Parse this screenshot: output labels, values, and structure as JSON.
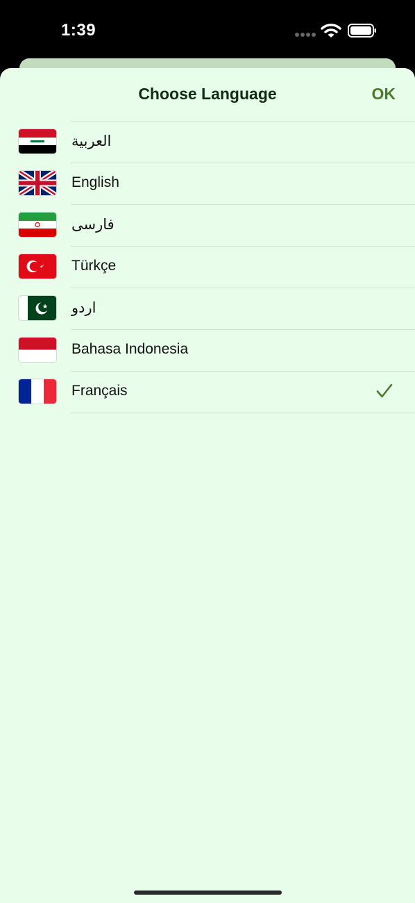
{
  "status_bar": {
    "time": "1:39",
    "icons": [
      "cellular-signal-icon",
      "wifi-icon",
      "battery-icon"
    ]
  },
  "sheet": {
    "title": "Choose Language",
    "ok_label": "OK",
    "background_color": "#e9feea",
    "accent_color": "#4b7a2a"
  },
  "languages": [
    {
      "label": "العربية",
      "flag": "iraq-flag-icon",
      "selected": false
    },
    {
      "label": "English",
      "flag": "uk-flag-icon",
      "selected": false
    },
    {
      "label": "فارسی",
      "flag": "iran-flag-icon",
      "selected": false
    },
    {
      "label": "Türkçe",
      "flag": "turkey-flag-icon",
      "selected": false
    },
    {
      "label": "اردو",
      "flag": "pakistan-flag-icon",
      "selected": false
    },
    {
      "label": "Bahasa Indonesia",
      "flag": "indonesia-flag-icon",
      "selected": false
    },
    {
      "label": "Français",
      "flag": "france-flag-icon",
      "selected": true
    }
  ]
}
